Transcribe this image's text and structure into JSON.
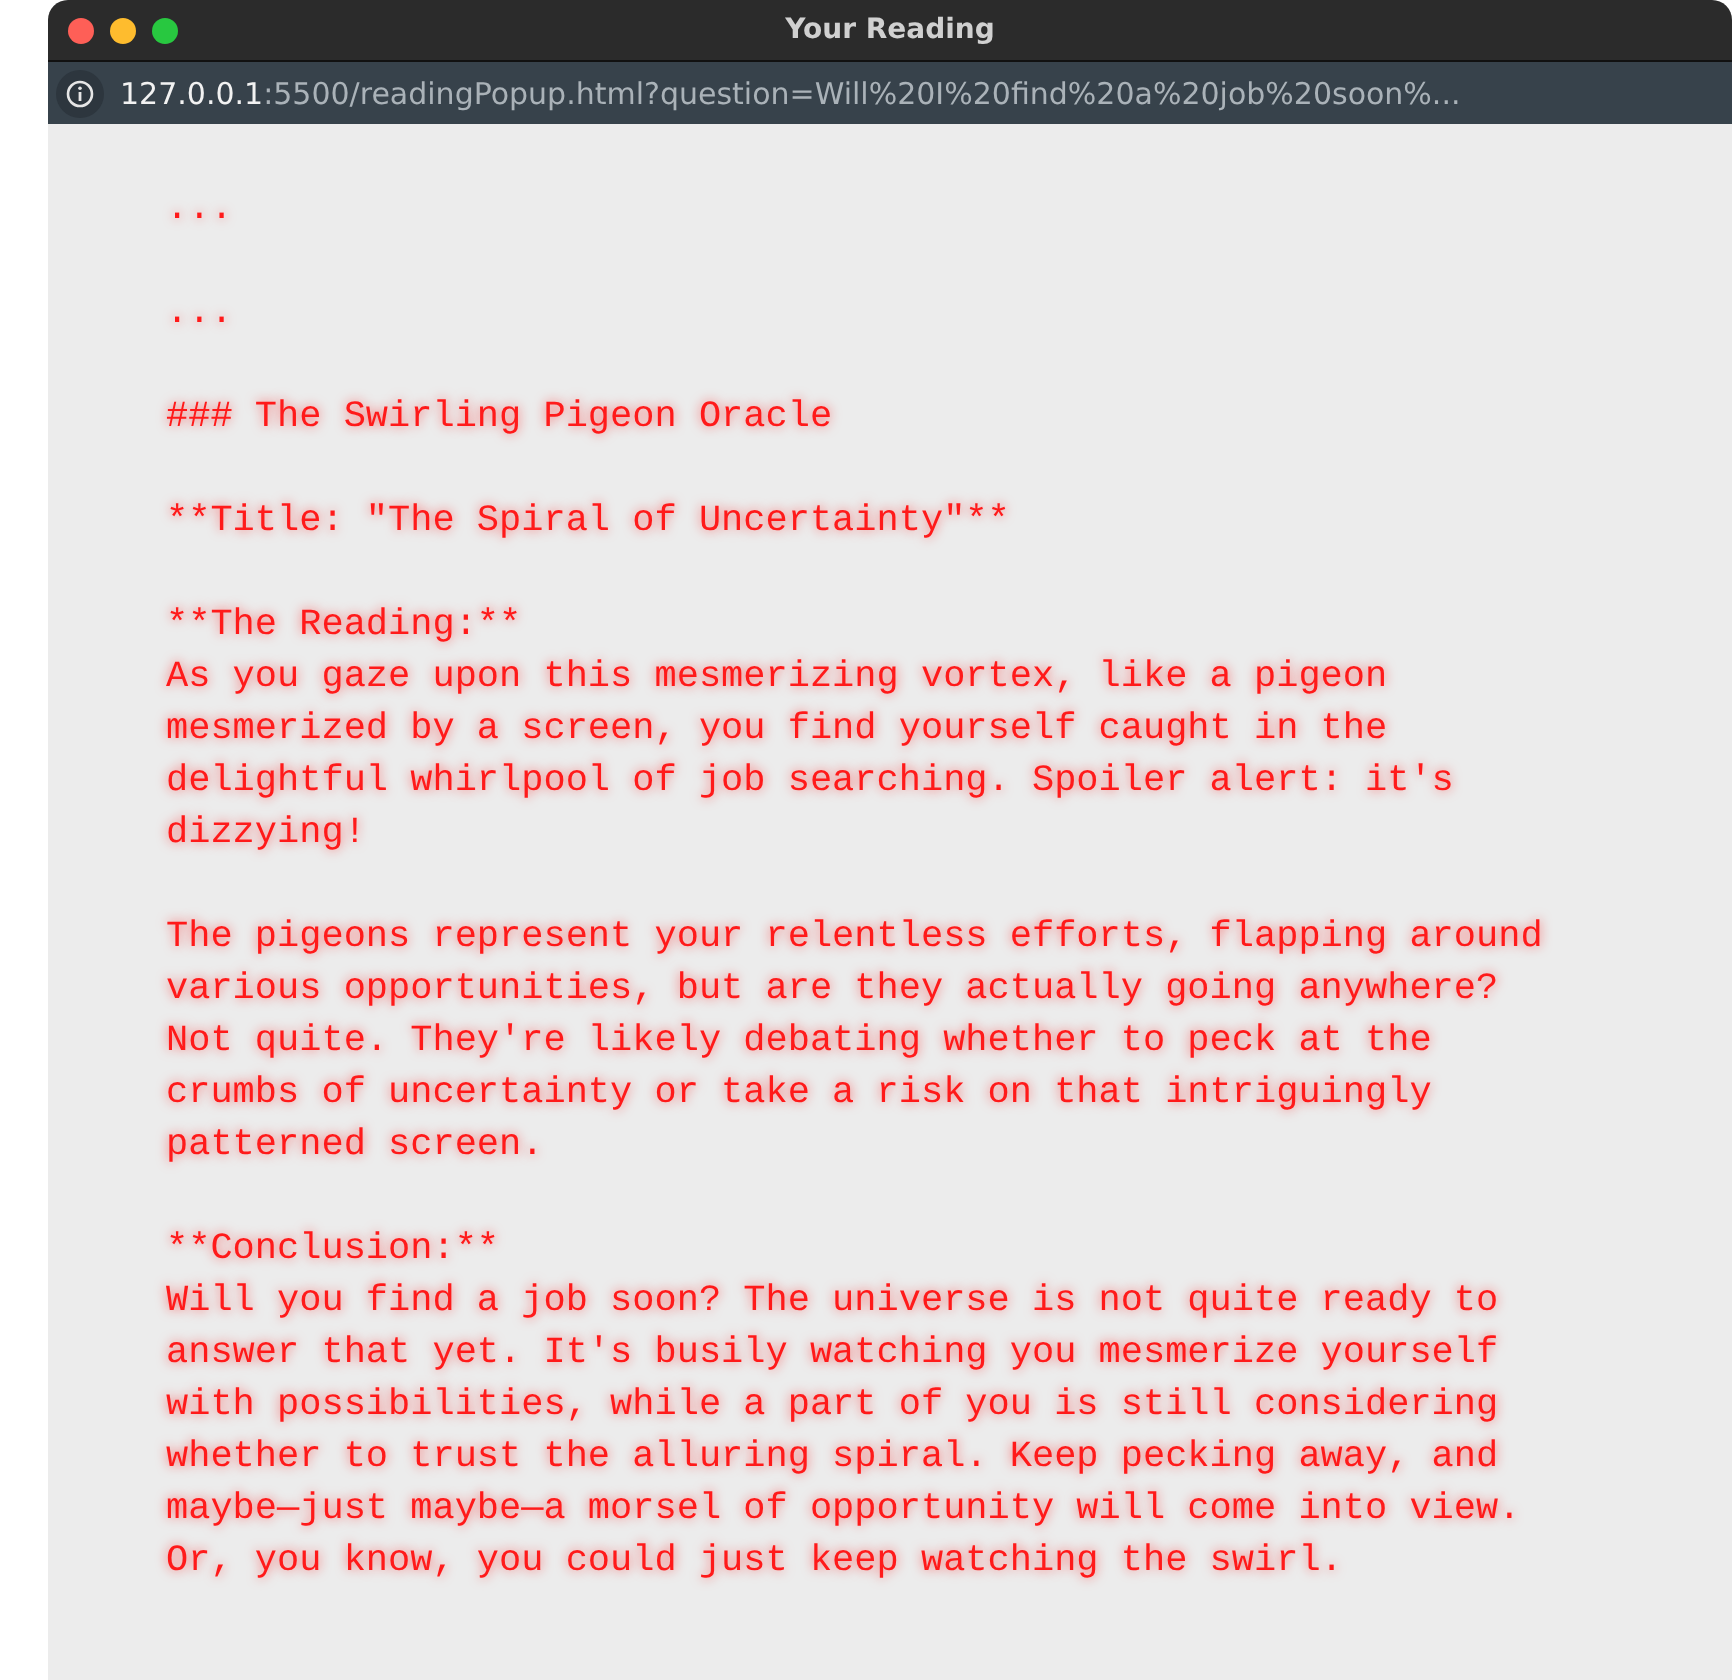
{
  "window": {
    "title": "Your Reading"
  },
  "address_bar": {
    "host": "127.0.0.1",
    "path": ":5500/readingPopup.html?question=Will%20I%20find%20a%20job%20soon%..."
  },
  "content": [
    {
      "kind": "line",
      "text": "..."
    },
    {
      "kind": "line",
      "text": "..."
    },
    {
      "kind": "line",
      "text": "### The Swirling Pigeon Oracle"
    },
    {
      "kind": "line",
      "text": "**Title: \"The Spiral of Uncertainty\"**"
    },
    {
      "kind": "section",
      "label": "**The Reading:**",
      "text": "As you gaze upon this mesmerizing vortex, like a pigeon mesmerized by a screen, you find yourself caught in the delightful whirlpool of job searching. Spoiler alert: it's dizzying!"
    },
    {
      "kind": "line",
      "text": "The pigeons represent your relentless efforts, flapping around various opportunities, but are they actually going anywhere? Not quite. They're likely debating whether to peck at the crumbs of uncertainty or take a risk on that intriguingly patterned screen."
    },
    {
      "kind": "section",
      "label": "**Conclusion:**",
      "text": "Will you find a job soon? The universe is not quite ready to answer that yet. It's busily watching you mesmerize yourself with possibilities, while a part of you is still considering whether to trust the alluring spiral. Keep pecking away, and maybe—just maybe—a morsel of opportunity will come into view. Or, you know, you could just keep watching the swirl."
    }
  ]
}
